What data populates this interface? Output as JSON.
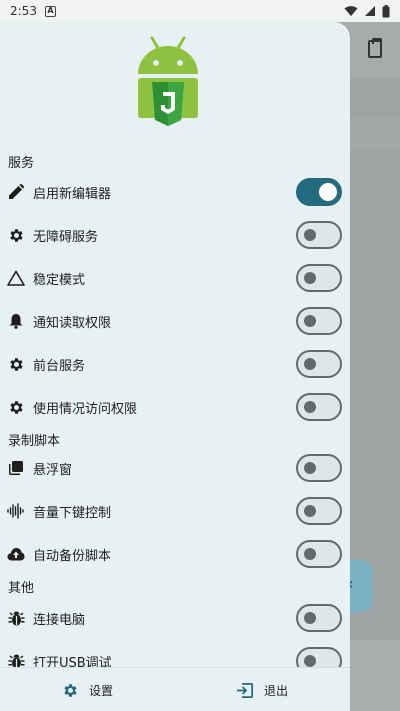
{
  "status_bar": {
    "time": "2:53",
    "notif_letter": "A"
  },
  "colors": {
    "accent": "#236b7e",
    "drawer_bg": "#e7f0f2",
    "scrim": "#9ea3a4"
  },
  "sections": [
    {
      "header": "服务",
      "items": [
        {
          "icon": "pencil-icon",
          "label": "启用新编辑器",
          "checked": true
        },
        {
          "icon": "gear-icon",
          "label": "无障碍服务",
          "checked": false
        },
        {
          "icon": "warning-triangle-icon",
          "label": "稳定模式",
          "checked": false
        },
        {
          "icon": "bell-icon",
          "label": "通知读取权限",
          "checked": false
        },
        {
          "icon": "gear-icon",
          "label": "前台服务",
          "checked": false
        },
        {
          "icon": "gear-icon",
          "label": "使用情况访问权限",
          "checked": false
        }
      ]
    },
    {
      "header": "录制脚本",
      "items": [
        {
          "icon": "floating-window-icon",
          "label": "悬浮窗",
          "checked": false
        },
        {
          "icon": "audio-wave-icon",
          "label": "音量下键控制",
          "checked": false
        },
        {
          "icon": "cloud-upload-icon",
          "label": "自动备份脚本",
          "checked": false
        }
      ]
    },
    {
      "header": "其他",
      "items": [
        {
          "icon": "bug-icon",
          "label": "连接电脑",
          "checked": false
        },
        {
          "icon": "bug-icon",
          "label": "打开USB调试",
          "checked": false
        }
      ]
    }
  ],
  "bottom_bar": {
    "settings_label": "设置",
    "exit_label": "退出"
  },
  "background": {
    "fab_glyph": "‹"
  }
}
